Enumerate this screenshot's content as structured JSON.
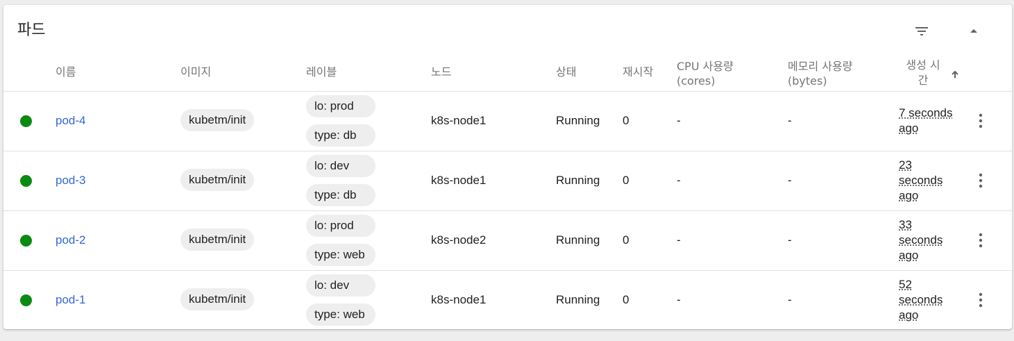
{
  "card": {
    "title": "파드",
    "filter_icon": "filter-list-icon",
    "collapse_icon": "arrow-drop-up-icon"
  },
  "columns": {
    "name": "이름",
    "image": "이미지",
    "labels": "레이블",
    "node": "노드",
    "status": "상태",
    "restarts": "재시작",
    "cpu_line1": "CPU 사용량",
    "cpu_line2": "(cores)",
    "mem_line1": "메모리 사용량",
    "mem_line2": "(bytes)",
    "created_line1": "생성 시",
    "created_line2": "간",
    "sort_icon": "arrow-upward-icon"
  },
  "colors": {
    "status_running": "#0b8a12",
    "link": "#3367d6",
    "chip_bg": "#eeeeee"
  },
  "rows": [
    {
      "name": "pod-4",
      "image": "kubetm/init",
      "label1": "lo: prod",
      "label2": "type: db",
      "node": "k8s-node1",
      "status": "Running",
      "restarts": "0",
      "cpu": "-",
      "memory": "-",
      "age_line1": "7 seconds",
      "age_line2": "ago",
      "age_line3": ""
    },
    {
      "name": "pod-3",
      "image": "kubetm/init",
      "label1": "lo: dev",
      "label2": "type: db",
      "node": "k8s-node1",
      "status": "Running",
      "restarts": "0",
      "cpu": "-",
      "memory": "-",
      "age_line1": "23",
      "age_line2": "seconds",
      "age_line3": "ago"
    },
    {
      "name": "pod-2",
      "image": "kubetm/init",
      "label1": "lo: prod",
      "label2": "type: web",
      "node": "k8s-node2",
      "status": "Running",
      "restarts": "0",
      "cpu": "-",
      "memory": "-",
      "age_line1": "33",
      "age_line2": "seconds",
      "age_line3": "ago"
    },
    {
      "name": "pod-1",
      "image": "kubetm/init",
      "label1": "lo: dev",
      "label2": "type: web",
      "node": "k8s-node1",
      "status": "Running",
      "restarts": "0",
      "cpu": "-",
      "memory": "-",
      "age_line1": "52",
      "age_line2": "seconds",
      "age_line3": "ago"
    }
  ]
}
